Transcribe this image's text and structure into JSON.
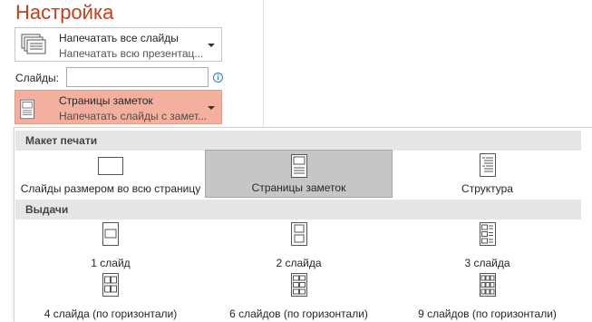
{
  "title": "Настройка",
  "print_scope": {
    "main": "Напечатать все слайды",
    "sub": "Напечатать всю презентац..."
  },
  "slides_label": "Слайды:",
  "slides_value": "",
  "layout_dropdown": {
    "main": "Страницы заметок",
    "sub": "Напечатать слайды с замет..."
  },
  "menu": {
    "layout_header": "Макет печати",
    "layout_options": [
      {
        "label": "Слайды размером во всю страницу",
        "icon": "full-page-slide-icon"
      },
      {
        "label": "Страницы заметок",
        "icon": "notes-page-icon",
        "selected": true
      },
      {
        "label": "Структура",
        "icon": "outline-icon"
      }
    ],
    "handouts_header": "Выдачи",
    "handouts": [
      {
        "label": "1 слайд",
        "icon": "handout-1-slide-icon"
      },
      {
        "label": "2 слайда",
        "icon": "handout-2-slides-icon"
      },
      {
        "label": "3 слайда",
        "icon": "handout-3-slides-icon"
      },
      {
        "label": "4 слайда (по горизонтали)",
        "icon": "handout-4-slides-icon"
      },
      {
        "label": "6 слайдов (по горизонтали)",
        "icon": "handout-6-slides-icon"
      },
      {
        "label": "9 слайдов (по горизонтали)",
        "icon": "handout-9-slides-icon"
      }
    ]
  },
  "colors": {
    "title": "#c43e1c",
    "selected_dropdown": "#f4b09e",
    "selected_option": "#c6c6c6",
    "section_header": "#e6e6e6",
    "info_icon": "#2b79d6"
  }
}
